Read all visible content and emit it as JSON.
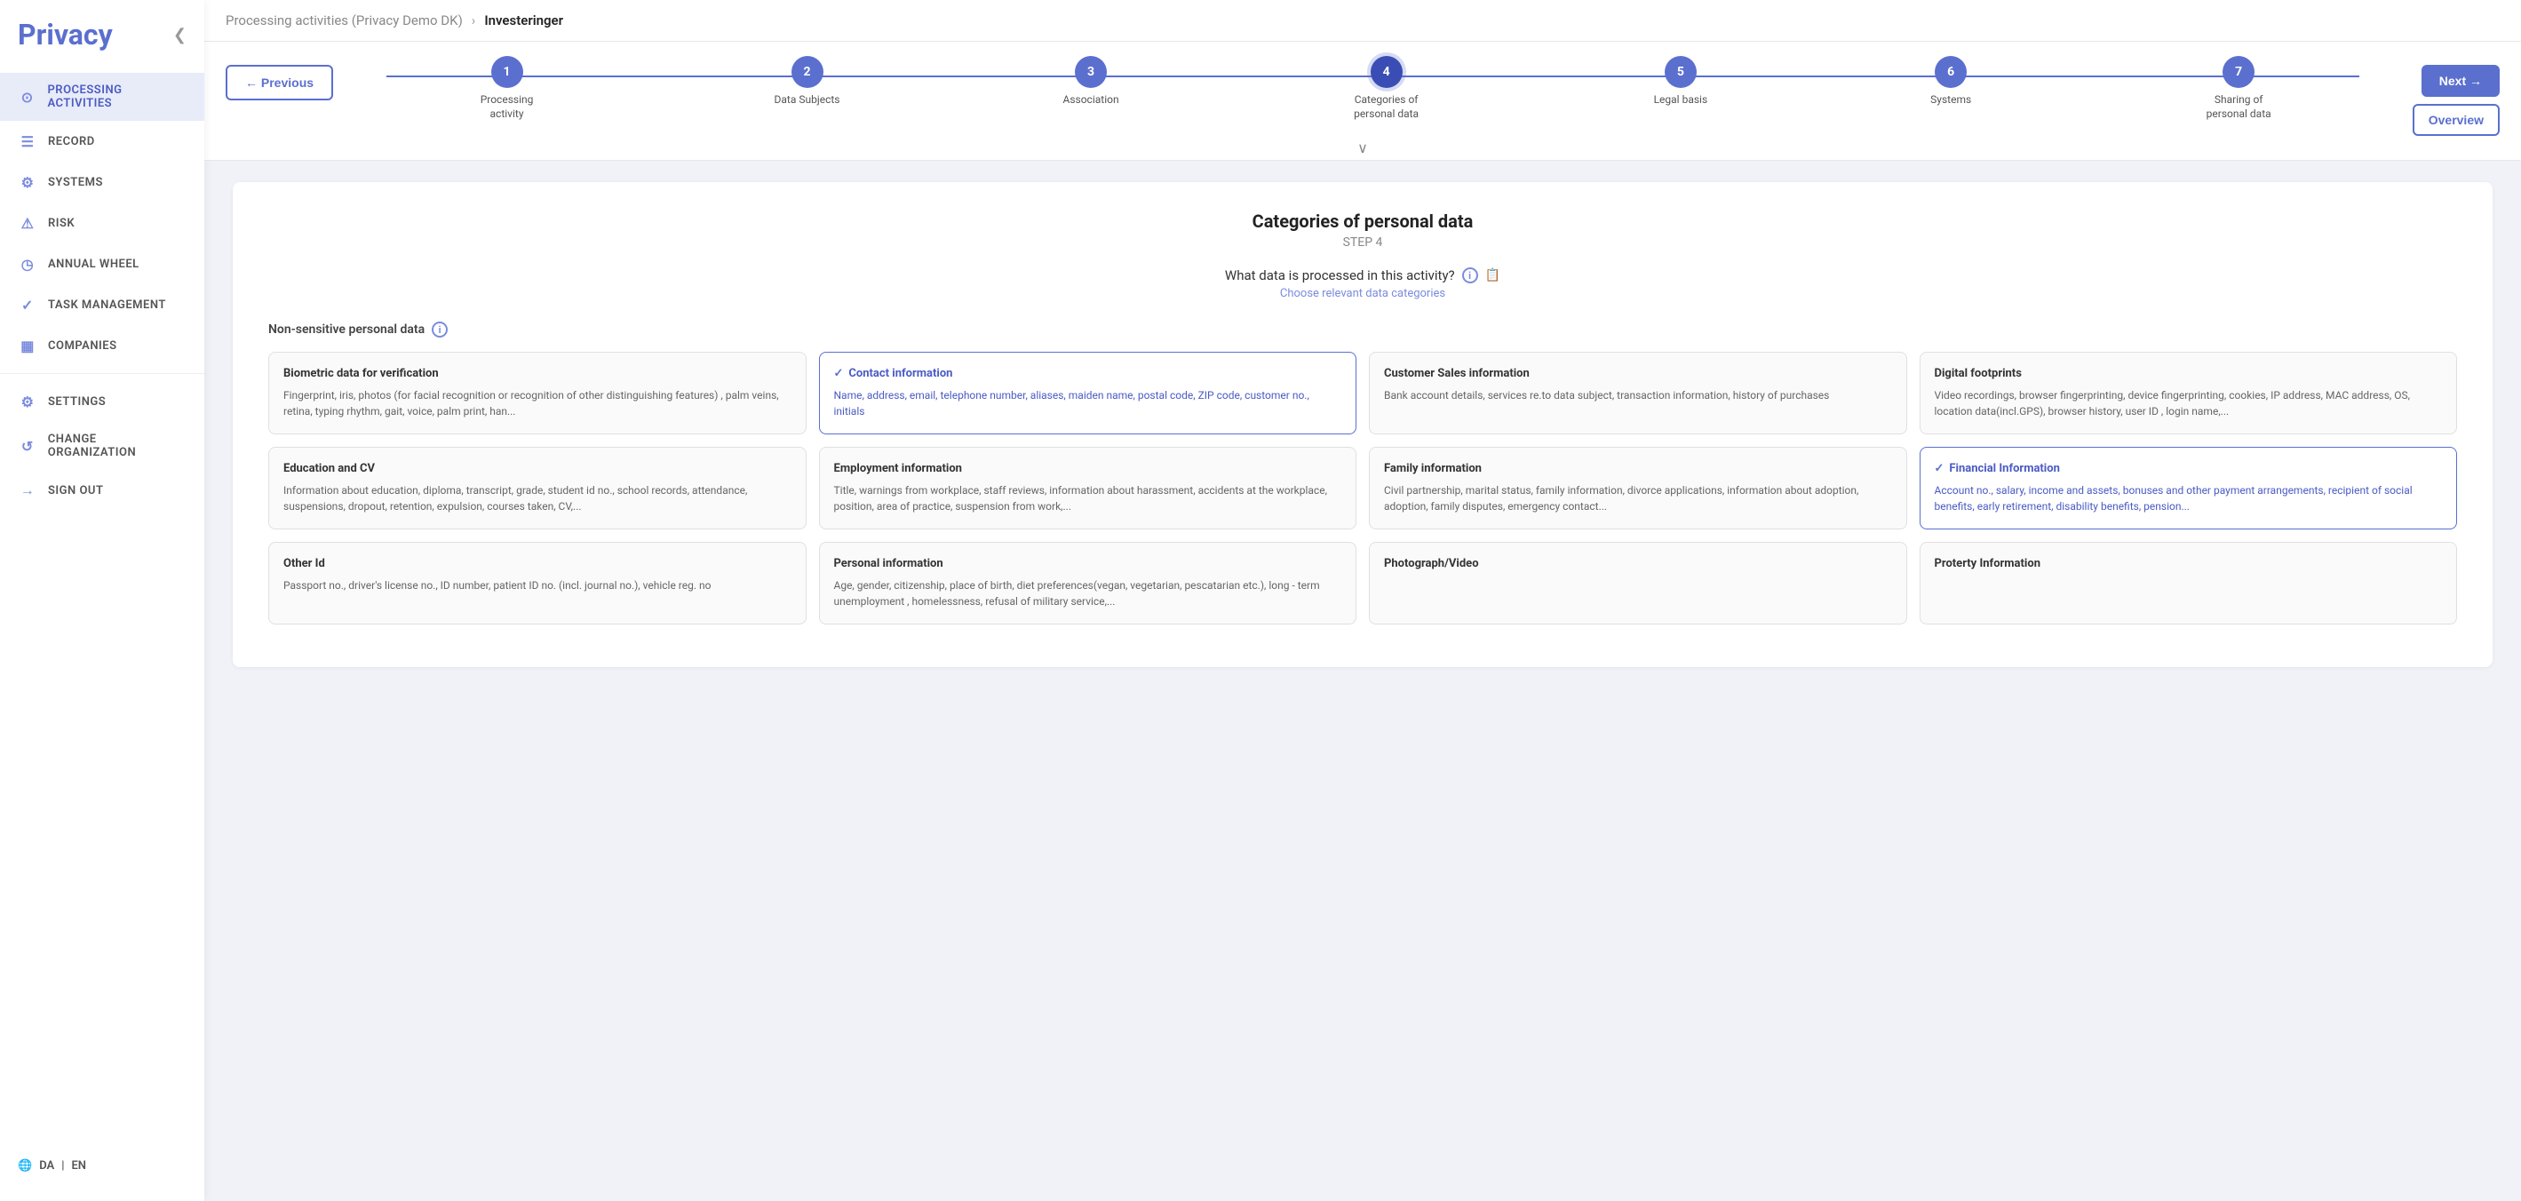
{
  "app": {
    "title": "Privacy",
    "collapse_icon": "❮"
  },
  "sidebar": {
    "items": [
      {
        "id": "processing-activities",
        "label": "Processing Activities",
        "icon": "⊙",
        "active": true
      },
      {
        "id": "record",
        "label": "Record",
        "icon": "☰"
      },
      {
        "id": "systems",
        "label": "Systems",
        "icon": "⚙"
      },
      {
        "id": "risk",
        "label": "Risk",
        "icon": "⚠"
      },
      {
        "id": "annual-wheel",
        "label": "Annual Wheel",
        "icon": "◷"
      },
      {
        "id": "task-management",
        "label": "Task Management",
        "icon": "✓"
      },
      {
        "id": "companies",
        "label": "Companies",
        "icon": "▦"
      },
      {
        "id": "settings",
        "label": "Settings",
        "icon": "⚙"
      },
      {
        "id": "change-organization",
        "label": "Change Organization",
        "icon": "↺"
      },
      {
        "id": "sign-out",
        "label": "Sign Out",
        "icon": "→"
      }
    ],
    "lang": {
      "da": "DA",
      "separator": "|",
      "en": "EN",
      "icon": "🌐"
    }
  },
  "breadcrumb": {
    "parent": "Processing activities (Privacy Demo DK)",
    "arrow": "›",
    "current": "Investeringer"
  },
  "stepper": {
    "prev_label": "← Previous",
    "next_label": "Next →",
    "overview_label": "Overview",
    "collapse_icon": "∨",
    "steps": [
      {
        "number": "1",
        "label": "Processing activity",
        "active": false
      },
      {
        "number": "2",
        "label": "Data Subjects",
        "active": false
      },
      {
        "number": "3",
        "label": "Association",
        "active": false
      },
      {
        "number": "4",
        "label": "Categories of personal data",
        "active": true
      },
      {
        "number": "5",
        "label": "Legal basis",
        "active": false
      },
      {
        "number": "6",
        "label": "Systems",
        "active": false
      },
      {
        "number": "7",
        "label": "Sharing of personal data",
        "active": false
      }
    ]
  },
  "content": {
    "title": "Categories of personal data",
    "step_label": "STEP 4",
    "question": "What data is processed in this activity?",
    "subtitle": "Choose relevant data categories",
    "section_label": "Non-sensitive personal data",
    "data_cards": [
      {
        "id": "biometric",
        "title": "Biometric data for verification",
        "description": "Fingerprint, iris, photos (for facial recognition or recognition of other distinguishing features) , palm veins, retina, typing rhythm, gait, voice, palm print, han...",
        "selected": false
      },
      {
        "id": "contact",
        "title": "Contact information",
        "description": "Name, address, email, telephone number, aliases, maiden name, postal code, ZIP code, customer no., initials",
        "selected": true
      },
      {
        "id": "customer-sales",
        "title": "Customer Sales information",
        "description": "Bank account details, services re.to data subject, transaction information, history of purchases",
        "selected": false
      },
      {
        "id": "digital-footprints",
        "title": "Digital footprints",
        "description": "Video recordings, browser fingerprinting, device fingerprinting, cookies, IP address, MAC address, OS, location data(incl.GPS), browser history, user ID , login name,...",
        "selected": false
      },
      {
        "id": "education-cv",
        "title": "Education and CV",
        "description": "Information about education, diploma, transcript, grade, student id no., school records, attendance, suspensions, dropout, retention, expulsion, courses taken, CV,...",
        "selected": false
      },
      {
        "id": "employment",
        "title": "Employment information",
        "description": "Title, warnings from workplace, staff reviews, information about harassment, accidents at the workplace, position, area of practice, suspension from work,...",
        "selected": false
      },
      {
        "id": "family",
        "title": "Family information",
        "description": "Civil partnership, marital status, family information, divorce applications, information about adoption, adoption, family disputes, emergency contact...",
        "selected": false
      },
      {
        "id": "financial",
        "title": "Financial Information",
        "description": "Account no., salary, income and assets, bonuses and other payment arrangements, recipient of social benefits, early retirement, disability benefits, pension...",
        "selected": true
      },
      {
        "id": "other-id",
        "title": "Other Id",
        "description": "Passport no., driver's license no., ID number, patient ID no. (incl. journal no.), vehicle reg. no",
        "selected": false
      },
      {
        "id": "personal-info",
        "title": "Personal information",
        "description": "Age, gender, citizenship, place of birth, diet preferences(vegan, vegetarian, pescatarian etc.), long - term unemployment , homelessness, refusal of military service,...",
        "selected": false
      },
      {
        "id": "photograph-video",
        "title": "Photograph/Video",
        "description": "",
        "selected": false
      },
      {
        "id": "property",
        "title": "Proterty Information",
        "description": "",
        "selected": false
      }
    ]
  }
}
